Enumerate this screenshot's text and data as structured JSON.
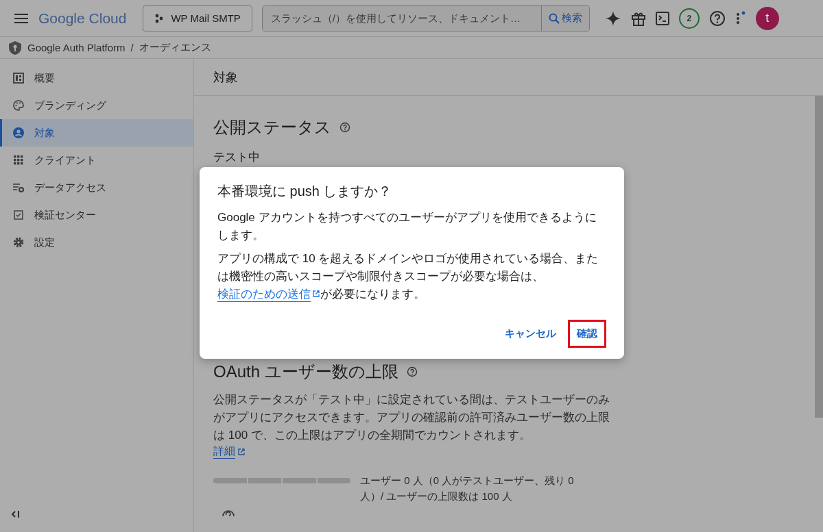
{
  "header": {
    "product": "Google Cloud",
    "project": "WP Mail SMTP",
    "search": {
      "placeholder": "スラッシュ（/）を使用してリソース、ドキュメント…",
      "button": "検索"
    },
    "notifications": "2",
    "avatar": "t"
  },
  "breadcrumb": [
    {
      "label": "Google Auth Platform"
    },
    {
      "label": "オーディエンス"
    }
  ],
  "breadcrumb_separator": "/",
  "sidebar": {
    "items": [
      {
        "label": "概要",
        "selected": false
      },
      {
        "label": "ブランディング",
        "selected": false
      },
      {
        "label": "対象",
        "selected": true
      },
      {
        "label": "クライアント",
        "selected": false
      },
      {
        "label": "データアクセス",
        "selected": false
      },
      {
        "label": "検証センター",
        "selected": false
      },
      {
        "label": "設定",
        "selected": false
      }
    ]
  },
  "page": {
    "title": "対象",
    "publish_status": {
      "heading": "公開ステータス",
      "value": "テスト中"
    },
    "user_cap": {
      "heading": "OAuth ユーザー数の上限",
      "description": "公開ステータスが「テスト中」に設定されている間は、テストユーザーのみがアプリにアクセスできます。アプリの確認前の許可済みユーザー数の上限は 100 で、この上限はアプリの全期間でカウントされます。",
      "link": "詳細",
      "reading": "ユーザー 0 人（0 人がテストユーザー、残り 0 人）/ ユーザーの上限数は 100 人"
    }
  },
  "dialog": {
    "title": "本番環境に push しますか？",
    "paragraphs": [
      "Google アカウントを持つすべてのユーザーがアプリを使用できるようにします。",
      "アプリの構成で 10 を超えるドメインやロゴが使用されている場合、または機密性の高いスコープや制限付きスコープが必要な場合は、"
    ],
    "link": "検証のための送信",
    "link_tail": "が必要になります。",
    "buttons": [
      {
        "label": "キャンセル",
        "highlighted": false
      },
      {
        "label": "確認",
        "highlighted": true
      }
    ]
  }
}
